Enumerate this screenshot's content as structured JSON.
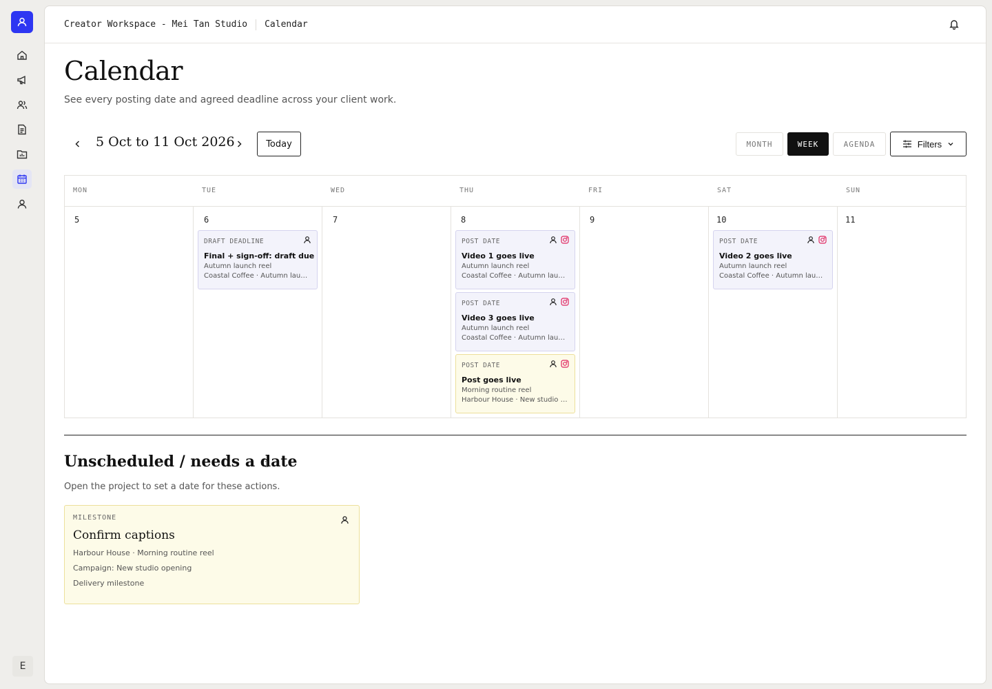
{
  "app": {
    "workspace": "Creator Workspace - Mei Tan Studio",
    "section": "Calendar",
    "user_initial": "E"
  },
  "sidebar": {
    "items": [
      {
        "name": "home-icon"
      },
      {
        "name": "megaphone-icon"
      },
      {
        "name": "users-icon"
      },
      {
        "name": "document-icon"
      },
      {
        "name": "folder-chart-icon"
      },
      {
        "name": "calendar-icon",
        "active": true
      },
      {
        "name": "user-icon"
      }
    ]
  },
  "page": {
    "title": "Calendar",
    "subtitle": "See every posting date and agreed deadline across your client work."
  },
  "controls": {
    "range": "5 Oct to 11 Oct 2026",
    "today": "Today",
    "views": [
      "MONTH",
      "WEEK",
      "AGENDA"
    ],
    "active_view": "WEEK",
    "filters": "Filters"
  },
  "calendar": {
    "days": [
      {
        "name": "MON",
        "num": "5"
      },
      {
        "name": "TUE",
        "num": "6"
      },
      {
        "name": "WED",
        "num": "7"
      },
      {
        "name": "THU",
        "num": "8"
      },
      {
        "name": "FRI",
        "num": "9"
      },
      {
        "name": "SAT",
        "num": "10"
      },
      {
        "name": "SUN",
        "num": "11"
      }
    ],
    "events": [
      {
        "type": "DRAFT DEADLINE",
        "title": "Final + sign-off: draft due",
        "line1": "Autumn launch reel",
        "line2": "Coastal Coffee · Autumn launch",
        "instagram": false,
        "color": "purple"
      },
      {
        "type": "POST DATE",
        "title": "Video 1 goes live",
        "line1": "Autumn launch reel",
        "line2": "Coastal Coffee · Autumn launch",
        "instagram": true,
        "color": "purple"
      },
      {
        "type": "POST DATE",
        "title": "Video 3 goes live",
        "line1": "Autumn launch reel",
        "line2": "Coastal Coffee · Autumn launch",
        "instagram": true,
        "color": "purple"
      },
      {
        "type": "POST DATE",
        "title": "Post goes live",
        "line1": "Morning routine reel",
        "line2": "Harbour House · New studio o...",
        "instagram": true,
        "color": "yellow"
      },
      {
        "type": "POST DATE",
        "title": "Video 2 goes live",
        "line1": "Autumn launch reel",
        "line2": "Coastal Coffee · Autumn launch",
        "instagram": true,
        "color": "purple"
      }
    ]
  },
  "unscheduled": {
    "title": "Unscheduled / needs a date",
    "count": "1",
    "subtitle": "Open the project to set a date for these actions.",
    "items": [
      {
        "type": "MILESTONE",
        "title": "Confirm captions",
        "line1": "Harbour House · Morning routine reel",
        "line2": "Campaign: New studio opening",
        "line3": "Delivery milestone"
      }
    ]
  },
  "colors": {
    "brand": "#2d36f2",
    "event_purple_bg": "#f3f3fb",
    "event_yellow_bg": "#fdfbe8",
    "instagram": "#e0245e"
  }
}
